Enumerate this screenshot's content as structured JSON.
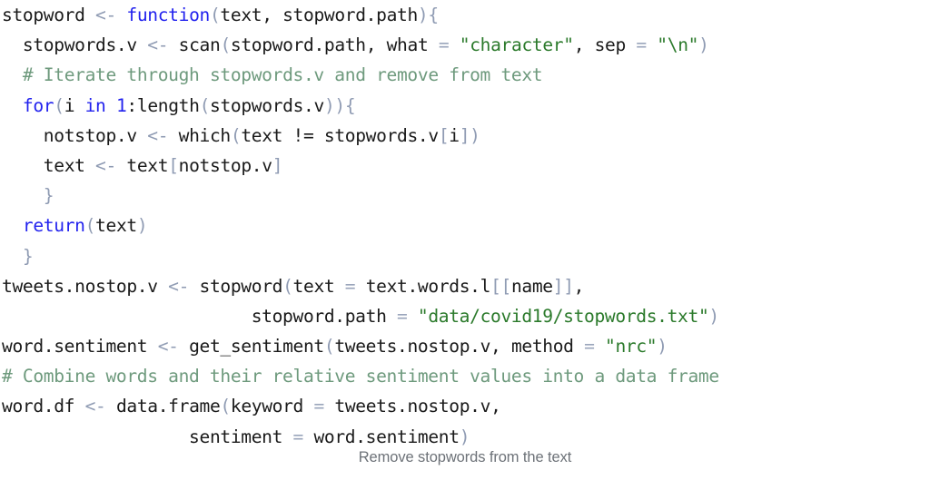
{
  "figure": {
    "language": "R",
    "background_color": "#ffffff",
    "caption": "Remove stopwords from the text"
  },
  "syntax_colors": {
    "plain": "#1a1a1a",
    "keyword": "#2222ee",
    "number": "#2222ee",
    "string": "#2b7a2b",
    "comment": "#6e9a7d",
    "punctuation": "#8f9bb3",
    "operator": "#9aa5bb",
    "caption": "#6d7278"
  },
  "code": {
    "line_count": 14,
    "lines": [
      "stopword <- function(text, stopword.path){",
      "  stopwords.v <- scan(stopword.path, what = \"character\", sep = \"\\n\")",
      "  # Iterate through stopwords.v and remove from text",
      "  for(i in 1:length(stopwords.v)){",
      "    notstop.v <- which(text != stopwords.v[i])",
      "    text <- text[notstop.v]",
      "    }",
      "  return(text)",
      "  }",
      "tweets.nostop.v <- stopword(text = text.words.l[[name]],",
      "                        stopword.path = \"data/covid19/stopwords.txt\")",
      "word.sentiment <- get_sentiment(tweets.nostop.v, method = \"nrc\")",
      "# Combine words and their relative sentiment values into a data frame",
      "word.df <- data.frame(keyword = tweets.nostop.v,",
      "                  sentiment = word.sentiment)"
    ],
    "tokens": {
      "line1": {
        "name": "stopword",
        "assign": "<-",
        "keyword": "function",
        "args": "text, stopword.path"
      },
      "line2": {
        "name": "stopwords.v",
        "call": "scan",
        "arg_path": "stopword.path",
        "what_param": "what",
        "what_value": "\"character\"",
        "sep_param": "sep",
        "sep_value": "\"\\n\""
      },
      "line3": {
        "comment": "# Iterate through stopwords.v and remove from text"
      },
      "line4": {
        "keyword": "for",
        "var": "i",
        "in_kw": "in",
        "from": "1",
        "call": "length",
        "arg": "stopwords.v"
      },
      "line5": {
        "name": "notstop.v",
        "call": "which",
        "expr": "text != stopwords.v[i]"
      },
      "line6": {
        "name": "text",
        "expr": "text[notstop.v]"
      },
      "line7": {
        "brace": "}"
      },
      "line8": {
        "keyword": "return",
        "arg": "text"
      },
      "line9": {
        "brace": "}"
      },
      "line10": {
        "name": "tweets.nostop.v",
        "call": "stopword",
        "param": "text",
        "value": "text.words.l[[name]]"
      },
      "line11": {
        "param": "stopword.path",
        "value": "\"data/covid19/stopwords.txt\""
      },
      "line12": {
        "name": "word.sentiment",
        "call": "get_sentiment",
        "arg": "tweets.nostop.v",
        "param": "method",
        "value": "\"nrc\""
      },
      "line13": {
        "comment": "# Combine words and their relative sentiment values into a data frame"
      },
      "line14": {
        "name": "word.df",
        "call": "data.frame",
        "param": "keyword",
        "value": "tweets.nostop.v"
      },
      "line15": {
        "param": "sentiment",
        "value": "word.sentiment"
      }
    }
  }
}
